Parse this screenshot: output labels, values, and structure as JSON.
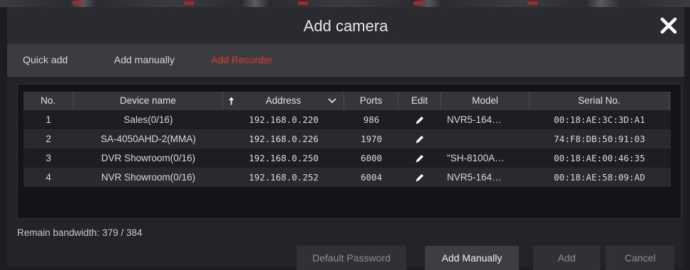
{
  "dialog": {
    "title": "Add camera",
    "close_icon": "close-icon"
  },
  "tabs": [
    {
      "label": "Quick add"
    },
    {
      "label": "Add manually"
    },
    {
      "label": "Add Recorder"
    }
  ],
  "table": {
    "headers": {
      "no": "No.",
      "device_name": "Device name",
      "address": "Address",
      "ports": "Ports",
      "edit": "Edit",
      "model": "Model",
      "serial": "Serial No."
    },
    "rows": [
      {
        "no": "1",
        "device_name": "Sales(0/16)",
        "address": "192.168.0.220",
        "ports": "986",
        "model": "NVR5-164…",
        "serial": "00:18:AE:3C:3D:A1"
      },
      {
        "no": "2",
        "device_name": "SA-4050AHD-2(MMA)",
        "address": "192.168.0.226",
        "ports": "1970",
        "model": "",
        "serial": "74:F8:DB:50:91:03"
      },
      {
        "no": "3",
        "device_name": "DVR Showroom(0/16)",
        "address": "192.168.0.250",
        "ports": "6000",
        "model": "\"SH-8100A…",
        "serial": "00:18:AE:00:46:35"
      },
      {
        "no": "4",
        "device_name": "NVR Showroom(0/16)",
        "address": "192.168.0.252",
        "ports": "6004",
        "model": "NVR5-164…",
        "serial": "00:18:AE:58:09:AD"
      }
    ]
  },
  "footer": {
    "remain_bandwidth": "Remain bandwidth: 379 / 384",
    "buttons": {
      "default_password": "Default Password",
      "add_manually": "Add Manually",
      "add": "Add",
      "cancel": "Cancel"
    }
  },
  "colors": {
    "active_tab": "#e23b2e"
  }
}
